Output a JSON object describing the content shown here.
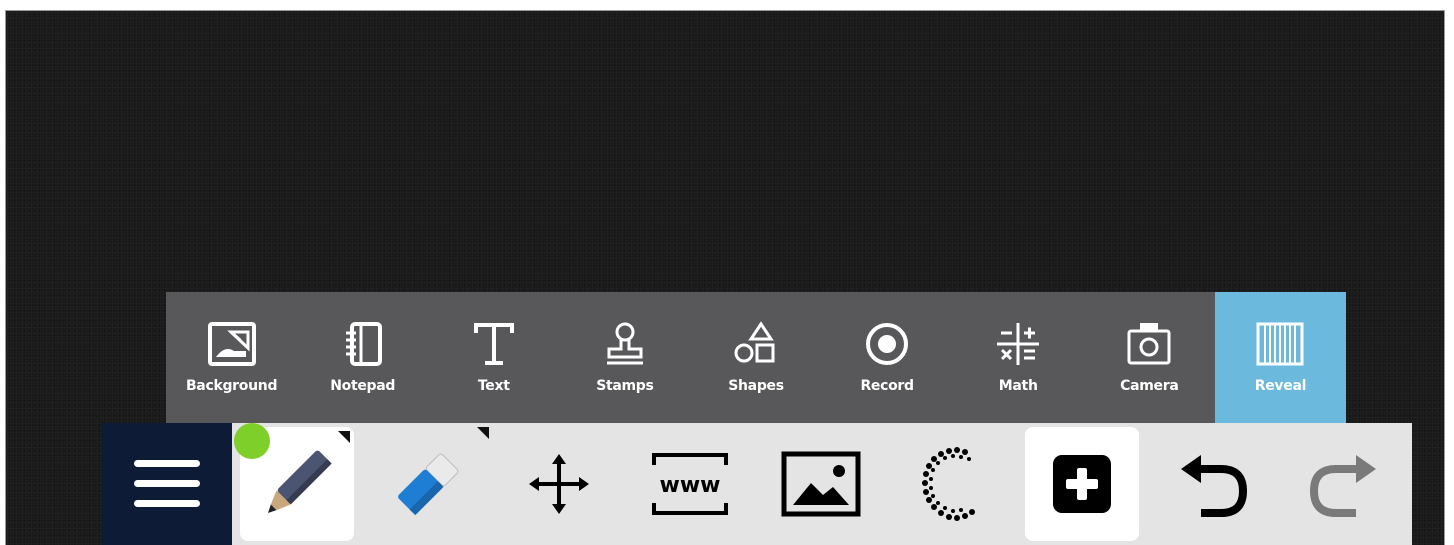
{
  "tools_panel": {
    "items": [
      {
        "label": "Background",
        "icon": "background-image-icon"
      },
      {
        "label": "Notepad",
        "icon": "notepad-icon"
      },
      {
        "label": "Text",
        "icon": "text-icon"
      },
      {
        "label": "Stamps",
        "icon": "stamp-icon"
      },
      {
        "label": "Shapes",
        "icon": "shapes-icon"
      },
      {
        "label": "Record",
        "icon": "record-icon"
      },
      {
        "label": "Math",
        "icon": "math-icon"
      },
      {
        "label": "Camera",
        "icon": "camera-icon"
      },
      {
        "label": "Reveal",
        "icon": "reveal-curtain-icon",
        "active": true
      }
    ],
    "active_color": "#6bb9dd",
    "background_color": "#58585a"
  },
  "toolbar": {
    "items": [
      {
        "name": "menu",
        "icon": "hamburger-menu-icon"
      },
      {
        "name": "pen",
        "icon": "marker-pen-icon",
        "selected": true,
        "pen_color": "#7fcf2a"
      },
      {
        "name": "eraser",
        "icon": "eraser-icon"
      },
      {
        "name": "move",
        "icon": "move-arrows-icon"
      },
      {
        "name": "website",
        "icon": "www-icon",
        "text": "www"
      },
      {
        "name": "image",
        "icon": "image-icon"
      },
      {
        "name": "loading",
        "icon": "spinner-icon"
      },
      {
        "name": "add",
        "icon": "add-icon"
      },
      {
        "name": "undo",
        "icon": "undo-icon"
      },
      {
        "name": "redo",
        "icon": "redo-icon",
        "disabled": true
      }
    ],
    "menu_color": "#0e1b36"
  },
  "canvas": {
    "background": "#1a1a1a"
  }
}
